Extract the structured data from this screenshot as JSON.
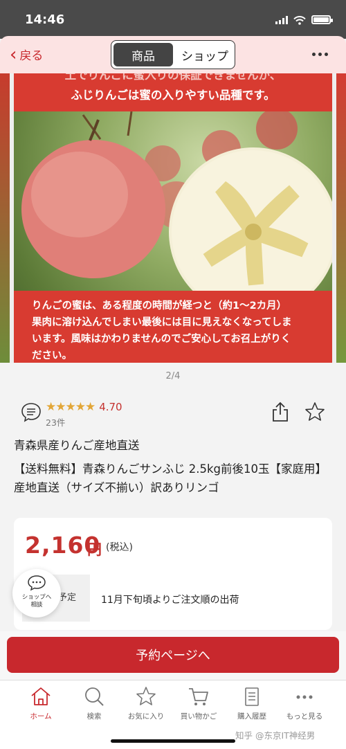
{
  "status_bar": {
    "time": "14:46"
  },
  "nav": {
    "back_label": "戻る",
    "segments": [
      "商品",
      "ショップ"
    ],
    "active_segment": 0
  },
  "hero": {
    "caption_top_faded": "土でりんごに蜜入りの保証できませんが、",
    "caption_top": "ふじりんごは蜜の入りやすい品種です。",
    "caption_bottom_1": "りんごの蜜は、ある程度の時間が経つと（約1～2カ月）",
    "caption_bottom_2": "果肉に溶け込んでしまい最後には目に見えなくなってしま",
    "caption_bottom_3": "います。風味はかわりませんのでご安心してお召上がりく",
    "caption_bottom_4": "ださい。",
    "pager": "2/4"
  },
  "rating": {
    "stars": "★★★★★",
    "value": "4.70",
    "reviews": "23件"
  },
  "product": {
    "shop_name": "青森県産りんご産地直送",
    "title": "【送料無料】青森りんごサンふじ 2.5kg前後10玉【家庭用】産地直送（サイズ不揃い）訳ありリンゴ"
  },
  "price": {
    "amount": "2,160",
    "currency": "円",
    "tax_label": "(税込)"
  },
  "shipping": {
    "label": "予定",
    "value": "11月下旬頃よりご注文順の出荷"
  },
  "float_chat": {
    "line1": "ショップへ",
    "line2": "相談"
  },
  "cta": {
    "label": "予約ページへ"
  },
  "tabbar": {
    "items": [
      {
        "label": "ホーム",
        "icon": "home-icon"
      },
      {
        "label": "検索",
        "icon": "search-icon"
      },
      {
        "label": "お気に入り",
        "icon": "star-icon"
      },
      {
        "label": "買い物かご",
        "icon": "cart-icon"
      },
      {
        "label": "購入履歴",
        "icon": "receipt-icon"
      },
      {
        "label": "もっと見る",
        "icon": "more-icon"
      }
    ]
  },
  "watermark": "知乎 @东京IT神经男",
  "colors": {
    "accent": "#c8282d",
    "star": "#e2a637",
    "caption_red": "#d83b31"
  }
}
